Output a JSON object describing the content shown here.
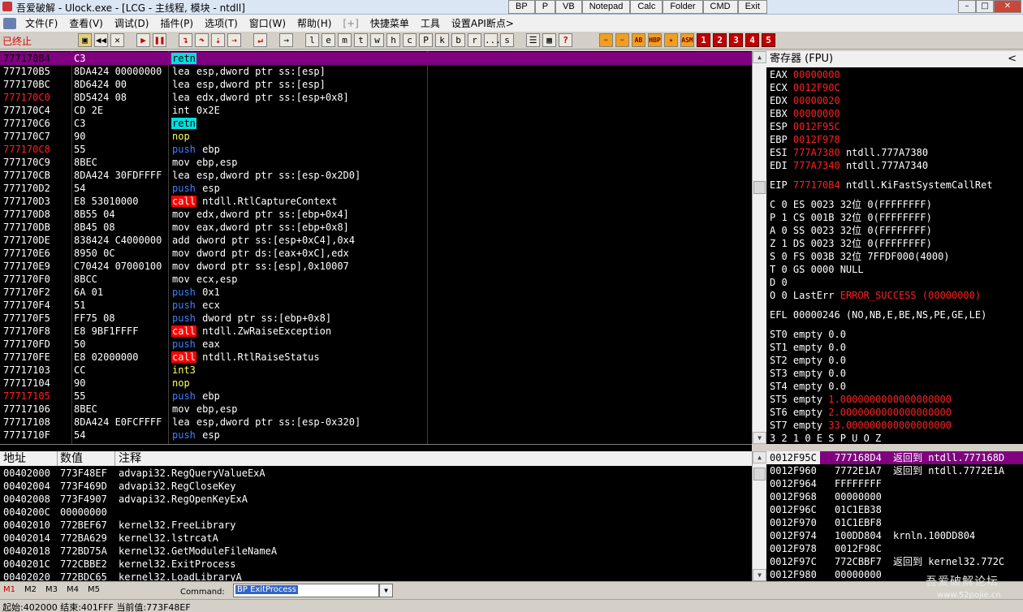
{
  "title": {
    "text": "吾爱破解 - Ulock.exe - [LCG - 主线程, 模块 - ntdll]",
    "quick_buttons": [
      "BP",
      "P",
      "VB",
      "Notepad",
      "Calc",
      "Folder",
      "CMD",
      "Exit"
    ],
    "window_controls": [
      "–",
      "□",
      "✕"
    ]
  },
  "menu": [
    "文件(F)",
    "查看(V)",
    "调试(D)",
    "插件(P)",
    "选项(T)",
    "窗口(W)",
    "帮助(H)",
    "[+]",
    "快捷菜单",
    "工具",
    "设置API断点>"
  ],
  "toolbar": {
    "status": "已终止",
    "letters": [
      "l",
      "e",
      "m",
      "t",
      "w",
      "h",
      "c",
      "P",
      "k",
      "b",
      "r",
      "...",
      "s"
    ],
    "asm_labels": [
      "HBP",
      "ASM"
    ],
    "numbers": [
      "1",
      "2",
      "3",
      "4",
      "5"
    ],
    "help": "?"
  },
  "cpu": {
    "rows": [
      {
        "addr": "777170B4",
        "hex": "C3",
        "mn": "retn",
        "ops": "",
        "mnc": "retn",
        "sel": true
      },
      {
        "addr": "777170B5",
        "hex": "8DA424 00000000",
        "mn": "lea",
        "ops": "esp,dword ptr ss:[esp]",
        "mnc": "lea"
      },
      {
        "addr": "777170BC",
        "hex": "8D6424 00",
        "mn": "lea",
        "ops": "esp,dword ptr ss:[esp]",
        "mnc": "lea"
      },
      {
        "addr": "777170C0",
        "hex": "8D5424 08",
        "mn": "lea",
        "ops": "edx,dword ptr ss:[esp+0x8]",
        "mnc": "lea",
        "red": true
      },
      {
        "addr": "777170C4",
        "hex": "CD 2E",
        "mn": "int",
        "ops": "0x2E",
        "mnc": "int"
      },
      {
        "addr": "777170C6",
        "hex": "C3",
        "mn": "retn",
        "ops": "",
        "mnc": "retn"
      },
      {
        "addr": "777170C7",
        "hex": "90",
        "mn": "nop",
        "ops": "",
        "mnc": "nop"
      },
      {
        "addr": "777170C8",
        "hex": "55",
        "mn": "push",
        "ops": "ebp",
        "mnc": "push",
        "red": true
      },
      {
        "addr": "777170C9",
        "hex": "8BEC",
        "mn": "mov",
        "ops": "ebp,esp",
        "mnc": "mov"
      },
      {
        "addr": "777170CB",
        "hex": "8DA424 30FDFFFF",
        "mn": "lea",
        "ops": "esp,dword ptr ss:[esp-0x2D0]",
        "mnc": "lea"
      },
      {
        "addr": "777170D2",
        "hex": "54",
        "mn": "push",
        "ops": "esp",
        "mnc": "push"
      },
      {
        "addr": "777170D3",
        "hex": "E8 53010000",
        "mn": "call",
        "ops": "ntdll.RtlCaptureContext",
        "mnc": "call"
      },
      {
        "addr": "777170D8",
        "hex": "8B55 04",
        "mn": "mov",
        "ops": "edx,dword ptr ss:[ebp+0x4]",
        "mnc": "mov"
      },
      {
        "addr": "777170DB",
        "hex": "8B45 08",
        "mn": "mov",
        "ops": "eax,dword ptr ss:[ebp+0x8]",
        "mnc": "mov"
      },
      {
        "addr": "777170DE",
        "hex": "838424 C4000000",
        "mn": "add",
        "ops": "dword ptr ss:[esp+0xC4],0x4",
        "mnc": "add"
      },
      {
        "addr": "777170E6",
        "hex": "8950 0C",
        "mn": "mov",
        "ops": "dword ptr ds:[eax+0xC],edx",
        "mnc": "mov"
      },
      {
        "addr": "777170E9",
        "hex": "C70424 07000100",
        "mn": "mov",
        "ops": "dword ptr ss:[esp],0x10007",
        "mnc": "mov"
      },
      {
        "addr": "777170F0",
        "hex": "8BCC",
        "mn": "mov",
        "ops": "ecx,esp",
        "mnc": "mov"
      },
      {
        "addr": "777170F2",
        "hex": "6A 01",
        "mn": "push",
        "ops": "0x1",
        "mnc": "push"
      },
      {
        "addr": "777170F4",
        "hex": "51",
        "mn": "push",
        "ops": "ecx",
        "mnc": "push"
      },
      {
        "addr": "777170F5",
        "hex": "FF75 08",
        "mn": "push",
        "ops": "dword ptr ss:[ebp+0x8]",
        "mnc": "push"
      },
      {
        "addr": "777170F8",
        "hex": "E8 9BF1FFFF",
        "mn": "call",
        "ops": "ntdll.ZwRaiseException",
        "mnc": "call"
      },
      {
        "addr": "777170FD",
        "hex": "50",
        "mn": "push",
        "ops": "eax",
        "mnc": "push"
      },
      {
        "addr": "777170FE",
        "hex": "E8 02000000",
        "mn": "call",
        "ops": "ntdll.RtlRaiseStatus",
        "mnc": "call"
      },
      {
        "addr": "77717103",
        "hex": "CC",
        "mn": "int3",
        "ops": "",
        "mnc": "int3"
      },
      {
        "addr": "77717104",
        "hex": "90",
        "mn": "nop",
        "ops": "",
        "mnc": "nop"
      },
      {
        "addr": "77717105",
        "hex": "55",
        "mn": "push",
        "ops": "ebp",
        "mnc": "push",
        "red": true
      },
      {
        "addr": "77717106",
        "hex": "8BEC",
        "mn": "mov",
        "ops": "ebp,esp",
        "mnc": "mov"
      },
      {
        "addr": "77717108",
        "hex": "8DA424 E0FCFFFF",
        "mn": "lea",
        "ops": "esp,dword ptr ss:[esp-0x320]",
        "mnc": "lea"
      },
      {
        "addr": "7771710F",
        "hex": "54",
        "mn": "push",
        "ops": "esp",
        "mnc": "push"
      }
    ]
  },
  "registers": {
    "header": "寄存器 (FPU)",
    "chevron": "<",
    "rows": [
      {
        "name": "EAX",
        "val": "00000000",
        "cmt": ""
      },
      {
        "name": "ECX",
        "val": "0012F90C",
        "cmt": ""
      },
      {
        "name": "EDX",
        "val": "00000020",
        "cmt": ""
      },
      {
        "name": "EBX",
        "val": "00000000",
        "cmt": ""
      },
      {
        "name": "ESP",
        "val": "0012F95C",
        "cmt": ""
      },
      {
        "name": "EBP",
        "val": "0012F978",
        "cmt": ""
      },
      {
        "name": "ESI",
        "val": "777A7380",
        "cmt": "ntdll.777A7380"
      },
      {
        "name": "EDI",
        "val": "777A7340",
        "cmt": "ntdll.777A7340"
      },
      {
        "name": "",
        "val": "",
        "cmt": ""
      },
      {
        "name": "EIP",
        "val": "777170B4",
        "cmt": "ntdll.KiFastSystemCallRet"
      },
      {
        "name": "",
        "val": "",
        "cmt": ""
      },
      {
        "name": "C 0  ES 0023 32位 0(FFFFFFFF)",
        "val": "",
        "cmt": ""
      },
      {
        "name": "P 1  CS 001B 32位 0(FFFFFFFF)",
        "val": "",
        "cmt": ""
      },
      {
        "name": "A 0  SS 0023 32位 0(FFFFFFFF)",
        "val": "",
        "cmt": ""
      },
      {
        "name": "Z 1  DS 0023 32位 0(FFFFFFFF)",
        "val": "",
        "cmt": ""
      },
      {
        "name": "S 0  FS 003B 32位 7FFDF000(4000)",
        "val": "",
        "cmt": ""
      },
      {
        "name": "T 0  GS 0000 NULL",
        "val": "",
        "cmt": ""
      },
      {
        "name": "D 0",
        "val": "",
        "cmt": ""
      },
      {
        "name": "O 0  LastErr",
        "val": "ERROR_SUCCESS (00000000)",
        "cmt": ""
      },
      {
        "name": "",
        "val": "",
        "cmt": ""
      },
      {
        "name": "EFL 00000246 (NO,NB,E,BE,NS,PE,GE,LE)",
        "val": "",
        "cmt": ""
      },
      {
        "name": "",
        "val": "",
        "cmt": ""
      },
      {
        "name": "ST0 empty 0.0",
        "val": "",
        "cmt": ""
      },
      {
        "name": "ST1 empty 0.0",
        "val": "",
        "cmt": ""
      },
      {
        "name": "ST2 empty 0.0",
        "val": "",
        "cmt": ""
      },
      {
        "name": "ST3 empty 0.0",
        "val": "",
        "cmt": ""
      },
      {
        "name": "ST4 empty 0.0",
        "val": "",
        "cmt": ""
      },
      {
        "name": "ST5 empty",
        "val": "1.0000000000000000000",
        "cmt": ""
      },
      {
        "name": "ST6 empty",
        "val": "2.0000000000000000000",
        "cmt": ""
      },
      {
        "name": "ST7 empty",
        "val": "33.000000000000000000",
        "cmt": ""
      },
      {
        "name": "               3 2 1 0      E S P U O Z",
        "val": "",
        "cmt": ""
      }
    ]
  },
  "dump": {
    "headers": [
      "地址",
      "数值",
      "注释"
    ],
    "rows": [
      {
        "addr": "00402000",
        "val": "773F48EF",
        "cmt": "advapi32.RegQueryValueExA"
      },
      {
        "addr": "00402004",
        "val": "773F469D",
        "cmt": "advapi32.RegCloseKey"
      },
      {
        "addr": "00402008",
        "val": "773F4907",
        "cmt": "advapi32.RegOpenKeyExA"
      },
      {
        "addr": "0040200C",
        "val": "00000000",
        "cmt": ""
      },
      {
        "addr": "00402010",
        "val": "772BEF67",
        "cmt": "kernel32.FreeLibrary"
      },
      {
        "addr": "00402014",
        "val": "772BA629",
        "cmt": "kernel32.lstrcatA"
      },
      {
        "addr": "00402018",
        "val": "772BD75A",
        "cmt": "kernel32.GetModuleFileNameA"
      },
      {
        "addr": "0040201C",
        "val": "772CBBE2",
        "cmt": "kernel32.ExitProcess"
      },
      {
        "addr": "00402020",
        "val": "772BDC65",
        "cmt": "kernel32.LoadLibraryA"
      }
    ]
  },
  "stack": {
    "rows": [
      {
        "addr": "0012F95C",
        "val": "777168D4",
        "cmt": "返回到 ntdll.777168D",
        "sel": true
      },
      {
        "addr": "0012F960",
        "val": "7772E1A7",
        "cmt": "返回到 ntdll.7772E1A"
      },
      {
        "addr": "0012F964",
        "val": "FFFFFFFF",
        "cmt": ""
      },
      {
        "addr": "0012F968",
        "val": "00000000",
        "cmt": ""
      },
      {
        "addr": "0012F96C",
        "val": "01C1EB38",
        "cmt": ""
      },
      {
        "addr": "0012F970",
        "val": "01C1EBF8",
        "cmt": ""
      },
      {
        "addr": "0012F974",
        "val": "100DD804",
        "cmt": "krnln.100DD804"
      },
      {
        "addr": "0012F978",
        "val": "0012F98C",
        "cmt": ""
      },
      {
        "addr": "0012F97C",
        "val": "772CBBF7",
        "cmt": "返回到 kernel32.772C"
      },
      {
        "addr": "0012F980",
        "val": "00000000",
        "cmt": ""
      }
    ]
  },
  "command": {
    "tabs": [
      "M1",
      "M2",
      "M3",
      "M4",
      "M5"
    ],
    "label": "Command:",
    "value": "BP ExitProcess",
    "dropdown": "▼"
  },
  "statusbar": {
    "text": "起始:402000 结束:401FFF 当前值:773F48EF"
  },
  "watermark": {
    "text": "吾爱破解论坛",
    "sub": "www.52pojie.cn"
  },
  "colors": {
    "selection": "#800080",
    "register_value": "#ff2020",
    "call_bg": "#ff0000",
    "retn_bg": "#00e0e0"
  }
}
